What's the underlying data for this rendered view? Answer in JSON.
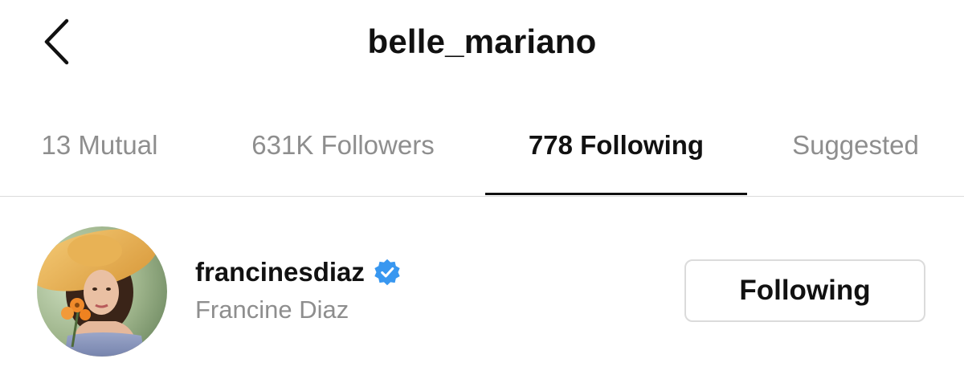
{
  "header": {
    "back_icon": "chevron-left-icon",
    "title": "belle_mariano"
  },
  "tabs": [
    {
      "label": "13 Mutual",
      "active": false
    },
    {
      "label": "631K Followers",
      "active": false
    },
    {
      "label": "778 Following",
      "active": true
    },
    {
      "label": "Suggested",
      "active": false
    }
  ],
  "list": [
    {
      "username": "francinesdiaz",
      "verified": true,
      "verified_icon": "verified-badge-icon",
      "full_name": "Francine Diaz",
      "button_label": "Following"
    }
  ],
  "colors": {
    "verified_blue": "#3897f0",
    "muted_text": "#8e8e8e",
    "border": "#dbdbdb"
  }
}
